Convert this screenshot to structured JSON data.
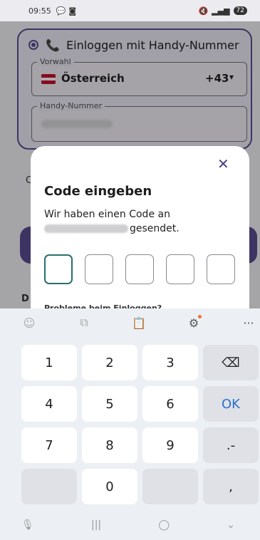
{
  "status_bar": {
    "time": "09:55",
    "battery": "72"
  },
  "background": {
    "login_option": "Einloggen mit Handy-Nummer",
    "prefix_label": "Vorwahl",
    "country": "Österreich",
    "country_code": "+43",
    "phone_label": "Handy-Nummer",
    "peek_letter_1": "C",
    "peek_letter_2": "D"
  },
  "dialog": {
    "close_symbol": "✕",
    "title": "Code eingeben",
    "body_line1": "Wir haben einen Code an",
    "body_line2_suffix": "gesendet.",
    "problems_link": "Probleme beim Einloggen?"
  },
  "keyboard": {
    "row1": [
      "1",
      "2",
      "3"
    ],
    "row2": [
      "4",
      "5",
      "6"
    ],
    "row3": [
      "7",
      "8",
      "9"
    ],
    "zero": "0",
    "ok": "OK",
    "dot_dash": ".-",
    "comma": ","
  },
  "colors": {
    "accent": "#5c4d93",
    "flag_red": "#c8102e",
    "code_focus": "#2a6f70",
    "ok_blue": "#2c6fd1"
  }
}
